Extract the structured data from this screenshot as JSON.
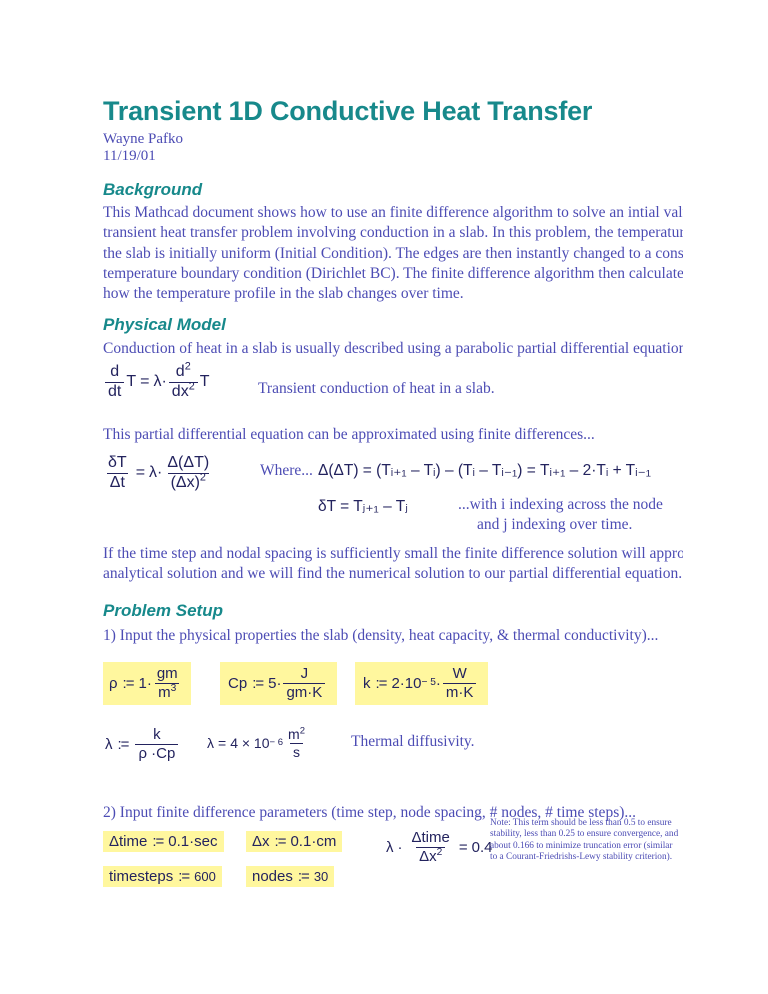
{
  "document": {
    "title": "Transient 1D Conductive Heat Transfer",
    "author": "Wayne Pafko",
    "date": "11/19/01"
  },
  "sections": {
    "background": {
      "heading": "Background",
      "paragraph_lines": [
        "This Mathcad document shows how to use an finite difference algorithm to solve an intial value",
        "transient heat transfer problem involving conduction in a slab.  In this problem, the temperature of",
        "the slab is initially uniform (Initial Condition).  The edges are then instantly changed to a constant",
        "temperature boundary condition (Dirichlet BC).  The finite difference algorithm then calculates",
        "how the temperature profile in the slab changes over time."
      ]
    },
    "physical_model": {
      "heading": "Physical Model",
      "intro": "Conduction of heat in a slab is usually described using a parabolic partial differential equation.",
      "pde": {
        "lhs_num": "d",
        "lhs_den": "dt",
        "lhs_var": "T",
        "equals": "=",
        "lambda": "λ",
        "dot": "·",
        "rhs_num": "d",
        "rhs_num_sup": "2",
        "rhs_den": "dx",
        "rhs_den_sup": "2",
        "rhs_var": "T",
        "caption": "Transient conduction of heat in a slab."
      },
      "fd_intro": "This partial differential equation can be approximated using finite differences...",
      "fd_equation": {
        "lhs_num": "δT",
        "lhs_den": "Δt",
        "equals": "=",
        "lambda": "λ",
        "dot": "·",
        "rhs_num": "Δ(ΔT)",
        "rhs_den": "(Δx)",
        "rhs_den_sup": "2"
      },
      "where_label": "Where...",
      "where_line1": "Δ(ΔT) = (Tᵢ₊₁ – Tᵢ) – (Tᵢ – Tᵢ₋₁) = Tᵢ₊₁ – 2·Tᵢ + Tᵢ₋₁",
      "where_line2": "δT = Tⱼ₊₁ – Tⱼ",
      "index_note_line1": "...with i  indexing across the node",
      "index_note_line2": "and j  indexing over time.",
      "closing_lines": [
        "If the time step and nodal spacing is sufficiently small the finite difference solution will approach the",
        "analytical solution and we will find the numerical solution to our partial differential equation."
      ]
    },
    "problem_setup": {
      "heading": "Problem Setup",
      "step1": "1) Input the physical properties the slab (density, heat capacity, & thermal conductivity)...",
      "definitions": {
        "rho": {
          "name": "ρ",
          "assign": ":=",
          "coefficient": "1",
          "dot": "·",
          "unit_num": "gm",
          "unit_den": "m",
          "unit_den_sup": "3"
        },
        "cp": {
          "name": "Cp",
          "assign": ":=",
          "coefficient": "5",
          "dot": "·",
          "unit_num": "J",
          "unit_den": "gm·K"
        },
        "k": {
          "name": "k",
          "assign": ":=",
          "coefficient": "2",
          "dot": "·",
          "power_base": "10",
          "power_exp": "− 5",
          "unit_num": "W",
          "unit_den": "m·K"
        }
      },
      "lambda_def": {
        "name": "λ",
        "assign": ":=",
        "num": "k",
        "den": "ρ ·Cp"
      },
      "lambda_result": {
        "name": "λ",
        "equals": "=",
        "value": "4 × 10",
        "exp": "− 6",
        "unit_num": "m",
        "unit_num_sup": "2",
        "unit_den": "s"
      },
      "lambda_caption": "Thermal diffusivity.",
      "step2": "2) Input finite difference parameters (time step, node spacing, # nodes, # time steps)...",
      "parameters": {
        "dtime": {
          "name": "Δtime",
          "assign": ":=",
          "value": "0.1",
          "dot": "·",
          "unit": "sec"
        },
        "dx": {
          "name": "Δx",
          "assign": ":=",
          "value": "0.1",
          "dot": "·",
          "unit": "cm"
        },
        "timesteps": {
          "name": "timesteps",
          "assign": ":=",
          "value": "600"
        },
        "nodes": {
          "name": "nodes",
          "assign": ":=",
          "value": "30"
        }
      },
      "stability": {
        "lambda": "λ",
        "dot": "·",
        "num": "Δtime",
        "den": "Δx",
        "den_sup": "2",
        "equals": "=",
        "value": "0.4"
      },
      "stability_note": "Note: This term should be less than 0.5 to ensure stability, less than 0.25 to ensure convergence, and about 0.166 to minimize truncation error (similar to a Courant-Friedrishs-Lewy stability criterion)."
    }
  },
  "colors": {
    "heading_teal": "#17898b",
    "body_blue": "#4c4cb4",
    "math_navy": "#23235e",
    "highlight_yellow": "#fff79e"
  }
}
